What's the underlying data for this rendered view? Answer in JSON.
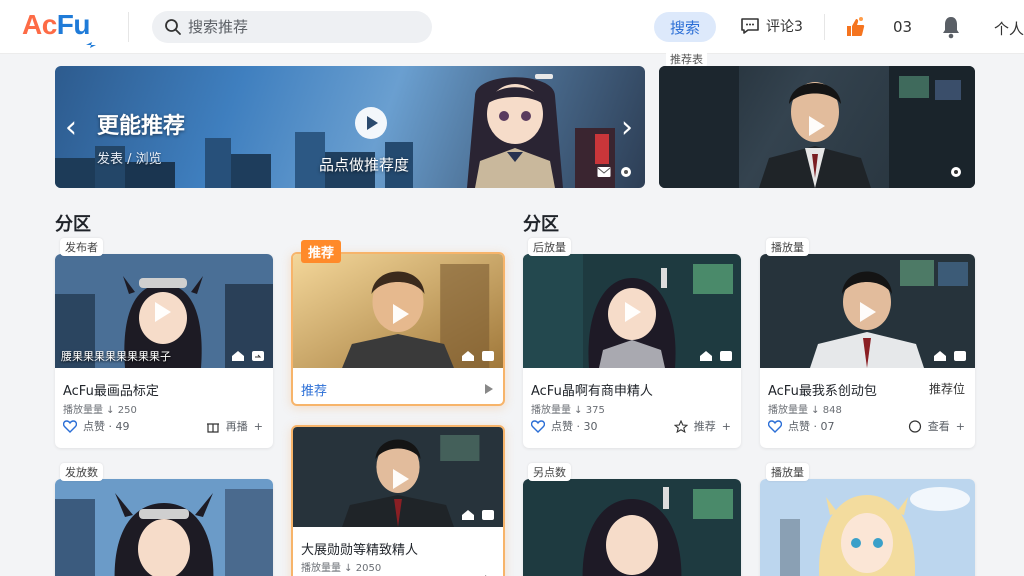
{
  "header": {
    "logo_a": "Ac",
    "logo_f": "Fu",
    "search_placeholder": "搜索推荐",
    "search_button": "搜索",
    "messages_label": "评论3",
    "like_count": "03",
    "user_label": "个人"
  },
  "banner_main": {
    "title": "更能推荐",
    "subtitle": "发表 / 浏览",
    "caption": "品点做推荐度"
  },
  "banner_side": {
    "tag": "推荐表"
  },
  "sections": {
    "left_title": "分区",
    "right_title": "分区"
  },
  "cards": [
    {
      "tag": "发布者",
      "overlay": "腰果果果果果果果果子",
      "title": "AcFu最画品标定",
      "meta": "播放量量 ↓ 250",
      "likes": "点赞 · 49",
      "share": "再播"
    },
    {
      "badge": "推荐",
      "label": "推荐"
    },
    {
      "tag": "后放量",
      "title": "AcFu晶啊有商申精人",
      "meta": "播放量量 ↓ 375",
      "likes": "点赞 · 30",
      "share": "推荐"
    },
    {
      "tag": "播放量",
      "title": "AcFu最我系创动包",
      "right_label": "推荐位",
      "meta": "播放量量 ↓ 848",
      "likes": "点赞 · 07",
      "share": "查看"
    },
    {
      "tag": "发放数"
    },
    {
      "title": "大展勋勋等精致精人",
      "meta": "播放量量 ↓ 2050"
    },
    {
      "tag": "另点数"
    },
    {
      "tag": "播放量"
    }
  ],
  "colors": {
    "accent_orange": "#fd6b46",
    "accent_blue": "#1f7bd8",
    "highlight": "#ff8a2a"
  }
}
